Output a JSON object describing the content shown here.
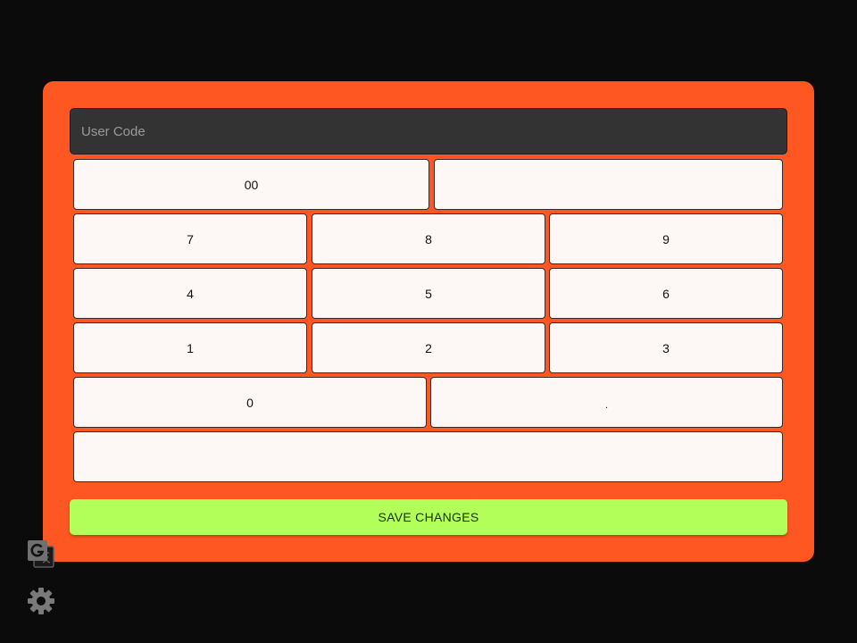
{
  "form": {
    "user_code": {
      "value": "",
      "placeholder": "User Code"
    }
  },
  "keypad": {
    "row1": [
      "00",
      ""
    ],
    "row2": [
      "7",
      "8",
      "9"
    ],
    "row3": [
      "4",
      "5",
      "6"
    ],
    "row4": [
      "1",
      "2",
      "3"
    ],
    "row5": [
      "0",
      "."
    ],
    "row6": [
      ""
    ]
  },
  "actions": {
    "save_label": "SAVE CHANGES"
  },
  "sidebar_icons": [
    "translate-icon",
    "settings-gear-icon"
  ],
  "colors": {
    "background": "#0b0b0b",
    "panel": "#ff5722",
    "input": "#333333",
    "key": "#fdf7f6",
    "save_button": "#b2ff59"
  }
}
